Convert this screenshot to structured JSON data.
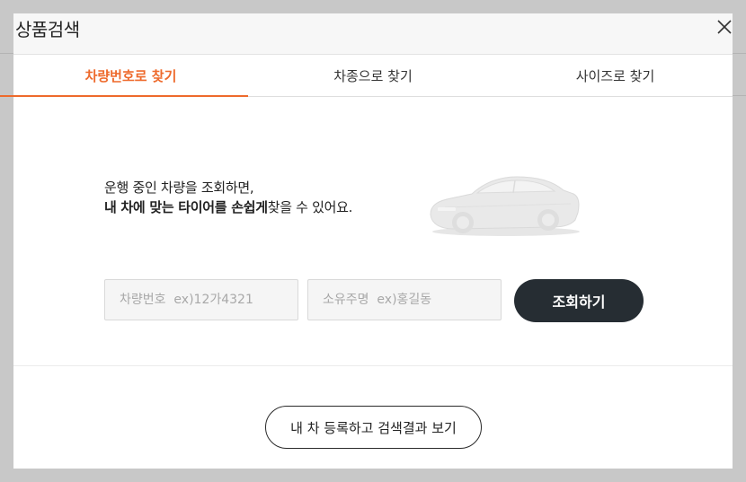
{
  "modal": {
    "title": "상품검색",
    "close_icon": "close-icon"
  },
  "tabs": [
    {
      "label": "차량번호로 찾기",
      "active": true
    },
    {
      "label": "차종으로 찾기",
      "active": false
    },
    {
      "label": "사이즈로 찾기",
      "active": false
    }
  ],
  "intro": {
    "line1": "운행 중인 차량을 조회하면,",
    "line2_bold": "내 차에 맞는 타이어를 손쉽게",
    "line2_rest": "찾을 수 있어요."
  },
  "form": {
    "plate_placeholder": "차량번호  ex)12가4321",
    "owner_placeholder": "소유주명  ex)홍길동",
    "search_label": "조회하기"
  },
  "footer": {
    "register_label": "내 차 등록하고 검색결과 보기"
  },
  "colors": {
    "accent": "#ee6a2c",
    "button_dark": "#262d33"
  }
}
